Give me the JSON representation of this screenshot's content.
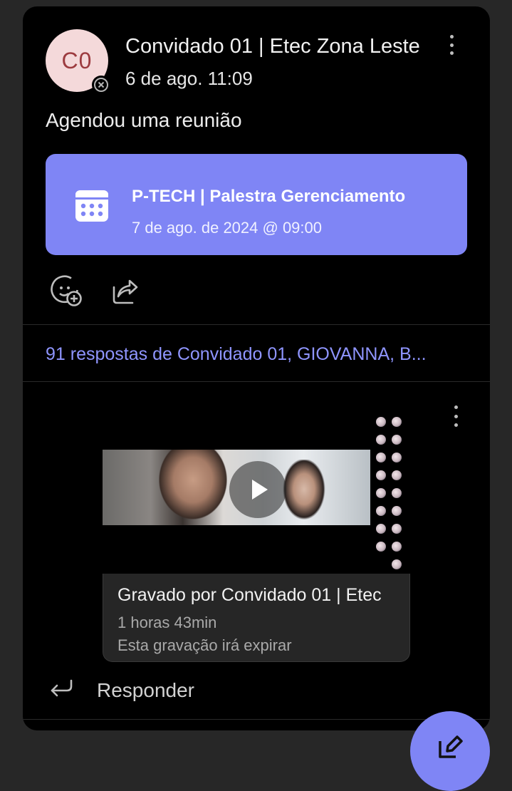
{
  "post": {
    "avatar_initials": "C0",
    "sender": "Convidado 01 | Etec Zona Leste",
    "timestamp": "6 de ago. 11:09",
    "action_text": "Agendou uma reunião",
    "meeting": {
      "title": "P-TECH | Palestra Gerenciamento",
      "datetime": "7 de ago. de 2024 @ 09:00"
    }
  },
  "thread": {
    "replies_summary": "91 respostas de Convidado 01, GIOVANNA, B..."
  },
  "recording": {
    "recorded_by_prefix": "Gravado por",
    "recorded_by_name": "Convidado 01 | Etec",
    "duration": "1 horas 43min",
    "expiry_note": "Esta gravação irá expirar"
  },
  "reply": {
    "label": "Responder"
  },
  "colors": {
    "accent": "#7f85f5",
    "link": "#8f95ff",
    "card_bg": "#000000",
    "page_bg": "#272727"
  },
  "icons": [
    "presence-offline-icon",
    "more-options-icon",
    "calendar-icon",
    "add-reaction-icon",
    "share-icon",
    "play-icon",
    "reply-arrow-icon",
    "compose-icon"
  ]
}
